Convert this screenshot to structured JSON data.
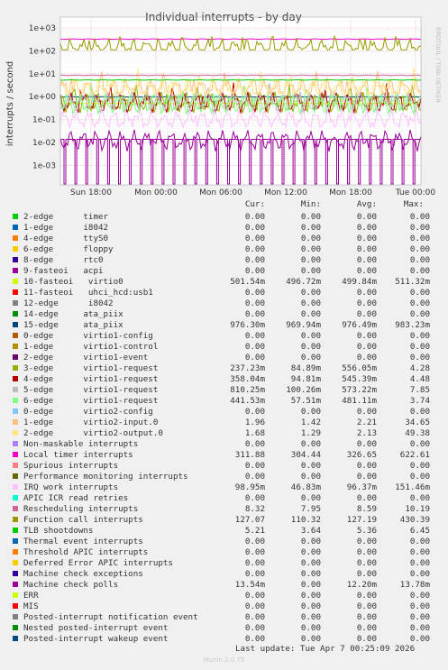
{
  "chart_data": {
    "type": "line",
    "title": "Individual interrupts - by day",
    "ylabel": "interrupts / second",
    "yscale": "log",
    "ylim": [
      0.0003,
      1000
    ],
    "y_ticks": [
      "1e-03",
      "1e-02",
      "1e-01",
      "1e+00",
      "1e+01",
      "1e+02",
      "1e+03"
    ],
    "x_ticks": [
      "Sun 18:00",
      "Mon 00:00",
      "Mon 06:00",
      "Mon 12:00",
      "Mon 18:00",
      "Tue 00:00"
    ],
    "watermark": "RRDTOOL / TOBI OETIKER",
    "grid": true,
    "columns": [
      "Cur:",
      "Min:",
      "Avg:",
      "Max:"
    ],
    "series": [
      {
        "name": "2-edge      timer",
        "color": "#00cc00",
        "values": [
          "0.00",
          "0.00",
          "0.00",
          "0.00"
        ]
      },
      {
        "name": "1-edge      i8042",
        "color": "#0066b3",
        "values": [
          "0.00",
          "0.00",
          "0.00",
          "0.00"
        ]
      },
      {
        "name": "4-edge      ttyS0",
        "color": "#ff8000",
        "values": [
          "0.00",
          "0.00",
          "0.00",
          "0.00"
        ]
      },
      {
        "name": "6-edge      floppy",
        "color": "#ffcc00",
        "values": [
          "0.00",
          "0.00",
          "0.00",
          "0.00"
        ]
      },
      {
        "name": "8-edge      rtc0",
        "color": "#330099",
        "values": [
          "0.00",
          "0.00",
          "0.00",
          "0.00"
        ]
      },
      {
        "name": "9-fasteoi   acpi",
        "color": "#990099",
        "values": [
          "0.00",
          "0.00",
          "0.00",
          "0.00"
        ]
      },
      {
        "name": "10-fasteoi   virtio0",
        "color": "#ccff00",
        "values": [
          "501.54m",
          "496.72m",
          "499.84m",
          "511.32m"
        ]
      },
      {
        "name": "11-fasteoi   uhci_hcd:usb1",
        "color": "#ff0000",
        "values": [
          "0.00",
          "0.00",
          "0.00",
          "0.00"
        ]
      },
      {
        "name": "12-edge      i8042",
        "color": "#808080",
        "values": [
          "0.00",
          "0.00",
          "0.00",
          "0.00"
        ]
      },
      {
        "name": "14-edge     ata_piix",
        "color": "#008f00",
        "values": [
          "0.00",
          "0.00",
          "0.00",
          "0.00"
        ]
      },
      {
        "name": "15-edge     ata_piix",
        "color": "#00487d",
        "values": [
          "976.30m",
          "969.94m",
          "976.49m",
          "983.23m"
        ]
      },
      {
        "name": "0-edge      virtio1-config",
        "color": "#b35a00",
        "values": [
          "0.00",
          "0.00",
          "0.00",
          "0.00"
        ]
      },
      {
        "name": "1-edge      virtio1-control",
        "color": "#b38f00",
        "values": [
          "0.00",
          "0.00",
          "0.00",
          "0.00"
        ]
      },
      {
        "name": "2-edge      virtio1-event",
        "color": "#6b006b",
        "values": [
          "0.00",
          "0.00",
          "0.00",
          "0.00"
        ]
      },
      {
        "name": "3-edge      virtio1-request",
        "color": "#8fb300",
        "values": [
          "237.23m",
          "84.89m",
          "556.05m",
          "4.28"
        ]
      },
      {
        "name": "4-edge      virtio1-request",
        "color": "#b30000",
        "values": [
          "358.04m",
          "94.81m",
          "545.39m",
          "4.48"
        ]
      },
      {
        "name": "5-edge      virtio1-request",
        "color": "#bebebe",
        "values": [
          "810.25m",
          "100.26m",
          "573.22m",
          "7.85"
        ]
      },
      {
        "name": "6-edge      virtio1-request",
        "color": "#80ff80",
        "values": [
          "441.53m",
          "57.51m",
          "481.11m",
          "3.74"
        ]
      },
      {
        "name": "0-edge      virtio2-config",
        "color": "#80c9ff",
        "values": [
          "0.00",
          "0.00",
          "0.00",
          "0.00"
        ]
      },
      {
        "name": "1-edge      virtio2-input.0",
        "color": "#ffc080",
        "values": [
          "1.96",
          "1.42",
          "2.21",
          "34.65"
        ]
      },
      {
        "name": "2-edge      virtio2-output.0",
        "color": "#ffe680",
        "values": [
          "1.68",
          "1.29",
          "2.13",
          "49.38"
        ]
      },
      {
        "name": "Non-maskable interrupts",
        "color": "#aa80ff",
        "values": [
          "0.00",
          "0.00",
          "0.00",
          "0.00"
        ]
      },
      {
        "name": "Local timer interrupts",
        "color": "#ee00cc",
        "values": [
          "311.88",
          "304.44",
          "326.65",
          "622.61"
        ]
      },
      {
        "name": "Spurious interrupts",
        "color": "#ff8080",
        "values": [
          "0.00",
          "0.00",
          "0.00",
          "0.00"
        ]
      },
      {
        "name": "Performance monitoring interrupts",
        "color": "#666600",
        "values": [
          "0.00",
          "0.00",
          "0.00",
          "0.00"
        ]
      },
      {
        "name": "IRQ work interrupts",
        "color": "#ffbfff",
        "values": [
          "98.95m",
          "46.83m",
          "96.37m",
          "151.46m"
        ]
      },
      {
        "name": "APIC ICR read retries",
        "color": "#00ffcc",
        "values": [
          "0.00",
          "0.00",
          "0.00",
          "0.00"
        ]
      },
      {
        "name": "Rescheduling interrupts",
        "color": "#cc6699",
        "values": [
          "8.32",
          "7.95",
          "8.59",
          "10.19"
        ]
      },
      {
        "name": "Function call interrupts",
        "color": "#999900",
        "values": [
          "127.07",
          "110.32",
          "127.19",
          "430.39"
        ]
      },
      {
        "name": "TLB shootdowns",
        "color": "#00cc00",
        "values": [
          "5.21",
          "3.64",
          "5.36",
          "6.45"
        ]
      },
      {
        "name": "Thermal event interrupts",
        "color": "#0066b3",
        "values": [
          "0.00",
          "0.00",
          "0.00",
          "0.00"
        ]
      },
      {
        "name": "Threshold APIC interrupts",
        "color": "#ff8000",
        "values": [
          "0.00",
          "0.00",
          "0.00",
          "0.00"
        ]
      },
      {
        "name": "Deferred Error APIC interrupts",
        "color": "#ffcc00",
        "values": [
          "0.00",
          "0.00",
          "0.00",
          "0.00"
        ]
      },
      {
        "name": "Machine check exceptions",
        "color": "#330099",
        "values": [
          "0.00",
          "0.00",
          "0.00",
          "0.00"
        ]
      },
      {
        "name": "Machine check polls",
        "color": "#990099",
        "values": [
          "13.54m",
          "0.00",
          "12.20m",
          "13.78m"
        ]
      },
      {
        "name": "ERR",
        "color": "#ccff00",
        "values": [
          "0.00",
          "0.00",
          "0.00",
          "0.00"
        ]
      },
      {
        "name": "MIS",
        "color": "#ff0000",
        "values": [
          "0.00",
          "0.00",
          "0.00",
          "0.00"
        ]
      },
      {
        "name": "Posted-interrupt notification event",
        "color": "#808080",
        "values": [
          "0.00",
          "0.00",
          "0.00",
          "0.00"
        ]
      },
      {
        "name": "Nested posted-interrupt event",
        "color": "#008f00",
        "values": [
          "0.00",
          "0.00",
          "0.00",
          "0.00"
        ]
      },
      {
        "name": "Posted-interrupt wakeup event",
        "color": "#00487d",
        "values": [
          "0.00",
          "0.00",
          "0.00",
          "0.00"
        ]
      }
    ],
    "last_update": "Last update: Tue Apr  7 00:25:09 2026",
    "footer": "Munin 2.0.75"
  }
}
